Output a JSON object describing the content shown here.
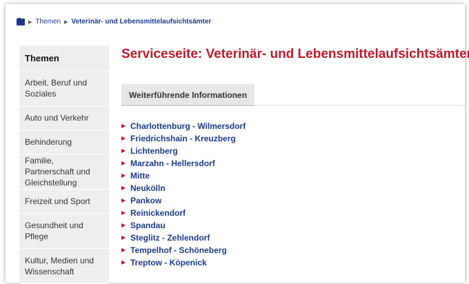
{
  "breadcrumb": {
    "items": [
      "Themen",
      "Veterinär- und Lebensmittelaufsichtsämter"
    ]
  },
  "sidebar": {
    "heading": "Themen",
    "items": [
      {
        "label": "Arbeit, Beruf und Soziales"
      },
      {
        "label": "Auto und Verkehr"
      },
      {
        "label": "Behinderung"
      },
      {
        "label": "Familie, Partnerschaft und Gleichstellung"
      },
      {
        "label": "Freizeit und Sport"
      },
      {
        "label": "Gesundheit und Pflege"
      },
      {
        "label": "Kultur, Medien und Wissenschaft"
      }
    ]
  },
  "main": {
    "title": "Serviceseite: Veterinär- und Lebensmittelaufsichtsämter",
    "tab_label": "Weiterführende Informationen",
    "districts": [
      "Charlottenburg - Wilmersdorf",
      "Friedrichshain - Kreuzberg",
      "Lichtenberg",
      "Marzahn - Hellersdorf",
      "Mitte",
      "Neukölln",
      "Pankow",
      "Reinickendorf",
      "Spandau",
      "Steglitz - Zehlendorf",
      "Tempelhof - Schöneberg",
      "Treptow - Köpenick"
    ]
  },
  "colors": {
    "accent_red": "#c0182a",
    "link_blue": "#1b3a8c",
    "sidebar_bg": "#eeeeee"
  }
}
